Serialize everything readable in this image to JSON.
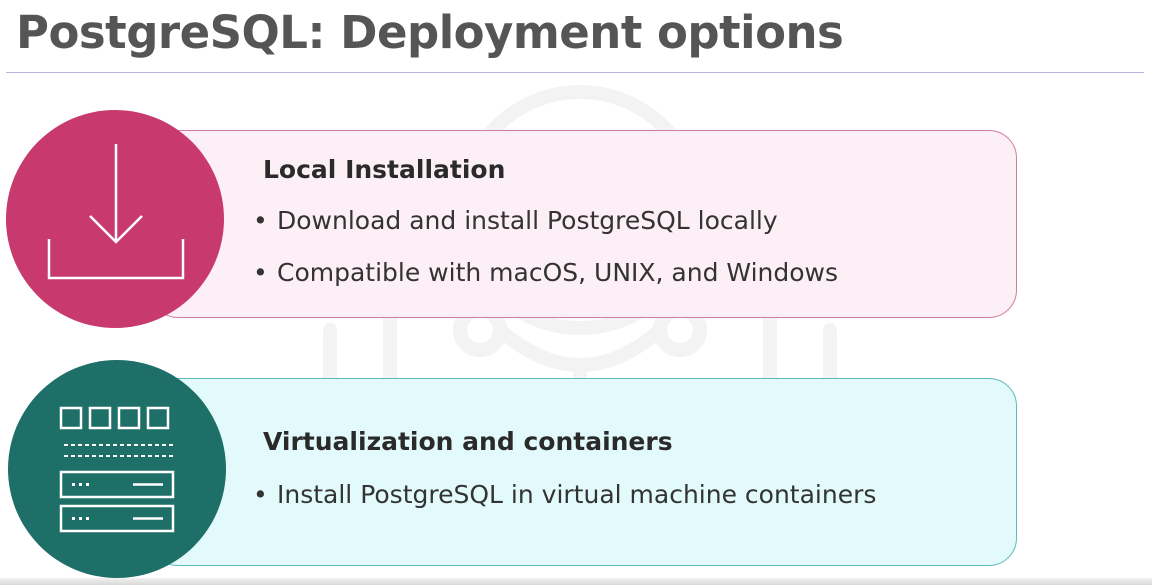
{
  "title": "PostgreSQL: Deployment options",
  "cards": [
    {
      "heading": "Local Installation",
      "icon": "download-icon",
      "bullets": [
        "Download and install PostgreSQL locally",
        "Compatible with macOS, UNIX, and Windows"
      ]
    },
    {
      "heading": "Virtualization and containers",
      "icon": "server-rack-icon",
      "bullets": [
        "Install PostgreSQL in virtual machine containers"
      ]
    }
  ],
  "colors": {
    "local_circle": "#c8396e",
    "local_card": "#fdeff6",
    "virtual_circle": "#1f6f69",
    "virtual_card": "#e2fafb"
  }
}
